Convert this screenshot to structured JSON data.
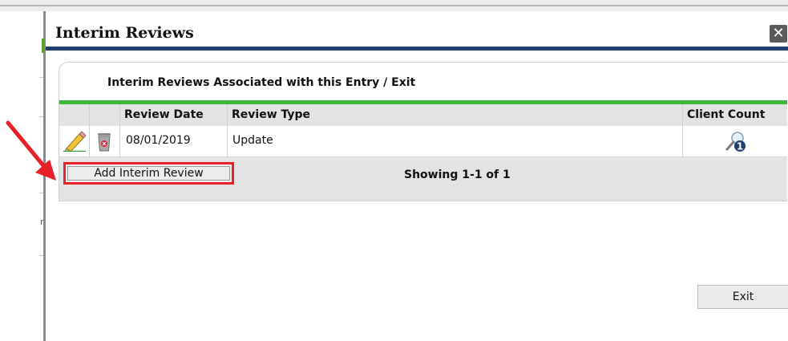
{
  "modal": {
    "title": "Interim Reviews",
    "close_symbol": "✕",
    "panel_header": "Interim Reviews Associated with this Entry / Exit",
    "table": {
      "columns": [
        "Review Date",
        "Review Type",
        "Client Count"
      ],
      "rows": [
        {
          "review_date": "08/01/2019",
          "review_type": "Update",
          "client_count": "1"
        }
      ]
    },
    "add_button_label": "Add Interim Review",
    "showing_text": "Showing 1-1 of 1",
    "exit_button_label": "Exit"
  },
  "background": {
    "partial_text": "r"
  },
  "colors": {
    "title_rule": "#1f3f70",
    "panel_accent": "#3bb73b",
    "annotation_red": "#e8202a"
  },
  "icons": [
    "edit-pencil-icon",
    "delete-trash-icon",
    "client-search-icon",
    "close-icon",
    "annotation-arrow"
  ]
}
